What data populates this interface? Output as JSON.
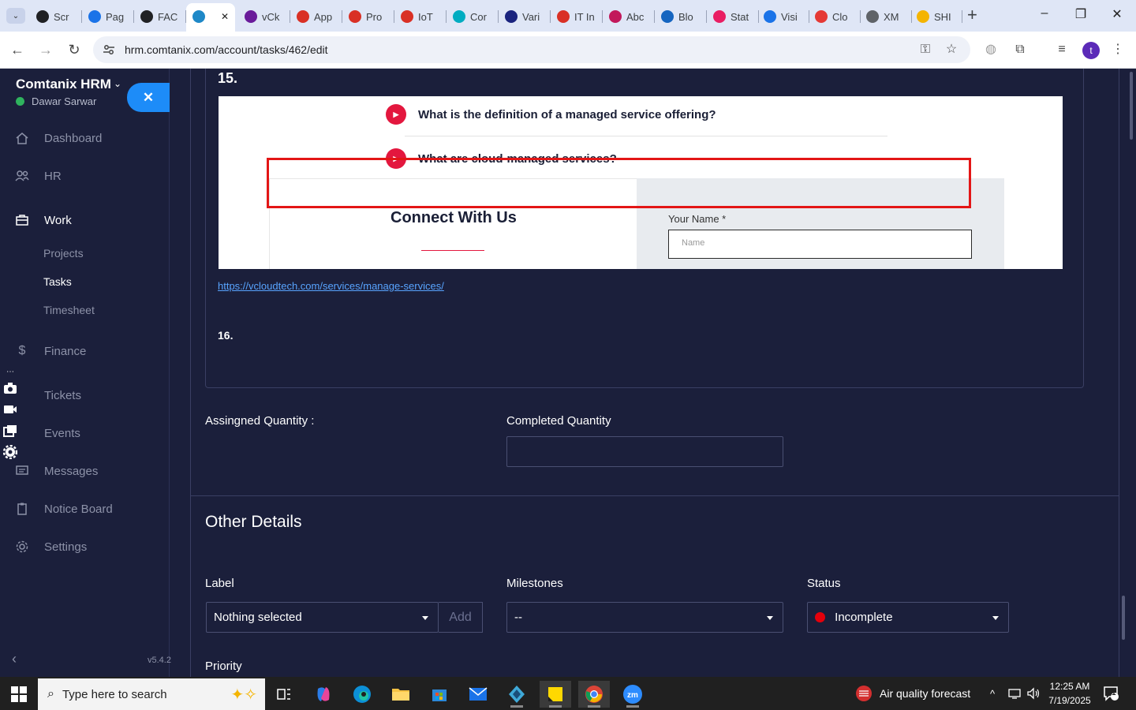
{
  "browser": {
    "tabs": [
      {
        "label": "Scr",
        "color": "#202124"
      },
      {
        "label": "Pag",
        "color": "#1a73e8"
      },
      {
        "label": "FAC",
        "color": "#202124"
      },
      {
        "label": "",
        "color": "#1e88c7",
        "active": true
      },
      {
        "label": "vCk",
        "color": "#6a1b9a"
      },
      {
        "label": "App",
        "color": "#d93025"
      },
      {
        "label": "Pro",
        "color": "#d93025"
      },
      {
        "label": "IoT",
        "color": "#d93025"
      },
      {
        "label": "Cor",
        "color": "#00acc1"
      },
      {
        "label": "Vari",
        "color": "#1a237e"
      },
      {
        "label": "IT In",
        "color": "#d93025"
      },
      {
        "label": "Abc",
        "color": "#c2185b"
      },
      {
        "label": "Blo",
        "color": "#1565c0"
      },
      {
        "label": "Stat",
        "color": "#e91e63"
      },
      {
        "label": "Visi",
        "color": "#1a73e8"
      },
      {
        "label": "Clo",
        "color": "#e53935"
      },
      {
        "label": "XM",
        "color": "#5f6368"
      },
      {
        "label": "SHI",
        "color": "#f4b400"
      }
    ],
    "url": "hrm.comtanix.com/account/tasks/462/edit"
  },
  "sidebar": {
    "brand": "Comtanix HRM",
    "user": "Dawar Sarwar",
    "items": [
      {
        "label": "Dashboard",
        "icon": "home-icon"
      },
      {
        "label": "HR",
        "icon": "users-icon"
      },
      {
        "label": "Work",
        "icon": "briefcase-icon",
        "active": true
      },
      {
        "label": "Finance",
        "icon": "dollar-icon"
      },
      {
        "label": "Tickets",
        "icon": "ticket-icon"
      },
      {
        "label": "Events",
        "icon": "calendar-icon"
      },
      {
        "label": "Messages",
        "icon": "message-icon"
      },
      {
        "label": "Notice Board",
        "icon": "clipboard-icon"
      },
      {
        "label": "Settings",
        "icon": "gear-icon"
      }
    ],
    "work_sub": [
      {
        "label": "Projects"
      },
      {
        "label": "Tasks",
        "active": true
      },
      {
        "label": "Timesheet"
      }
    ],
    "version": "v5.4.2"
  },
  "content": {
    "q15": "15.",
    "faq1": "What is the definition of a managed service offering?",
    "faq2": "What are cloud-managed services?",
    "connect_title": "Connect With Us",
    "your_name_label": "Your Name *",
    "name_placeholder": "Name",
    "link": "https://vcloudtech.com/services/manage-services/",
    "q16": "16.",
    "assigned_qty_label": "Assingned Quantity :",
    "completed_qty_label": "Completed Quantity",
    "completed_qty_value": "",
    "other_details": "Other Details",
    "label_label": "Label",
    "label_value": "Nothing selected",
    "add_button": "Add",
    "milestones_label": "Milestones",
    "milestones_value": "--",
    "status_label": "Status",
    "status_value": "Incomplete",
    "status_color": "#e5000b",
    "priority_label": "Priority"
  },
  "taskbar": {
    "search_placeholder": "Type here to search",
    "weather": "Air quality forecast",
    "time": "12:25 AM",
    "date": "7/19/2025",
    "notifications": "1"
  }
}
